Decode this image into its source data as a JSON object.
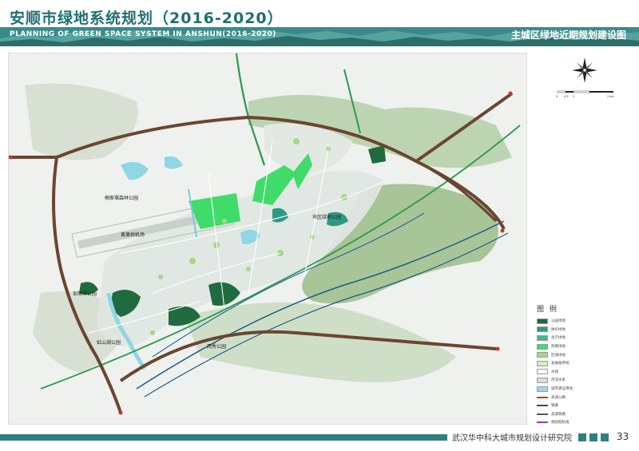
{
  "header": {
    "title_zh": "安顺市绿地系统规划（2016-2020）",
    "title_en": "PLANNING OF GREEN SPACE SYSTEM IN ANSHUN(2016-2020)",
    "subtitle": "主城区绿地近期规划建设图"
  },
  "map": {
    "labels": {
      "park_west": "梅家堰森林公园",
      "airport_line": "黄果树机场",
      "park_southwest": "安顺市公园",
      "park_south": "虹山湖公园",
      "park_east": "市区绿地公园",
      "park_se": "西秀公园"
    },
    "scale_bar": [
      "0",
      "0.5",
      "1",
      "2 km"
    ],
    "colors": {
      "background": "#eef1ee",
      "mountain_green": "#8fb57a",
      "ring_road": "#6b4530",
      "expressway": "#2a9a4a",
      "railway": "#1f5a88",
      "water": "#8fd6e6"
    }
  },
  "legend": {
    "title": "图 例",
    "items": [
      {
        "label": "公园绿地",
        "color": "#1f6b3f"
      },
      {
        "label": "防护绿地",
        "color": "#2b9a83"
      },
      {
        "label": "生产绿地",
        "color": "#3fb98f"
      },
      {
        "label": "附属绿地",
        "color": "#3fdc6a"
      },
      {
        "label": "区域绿地",
        "color": "#a6d68a"
      },
      {
        "label": "发展备用地",
        "color": "#dbe9c9"
      },
      {
        "label": "水域",
        "color": "#ffffff"
      },
      {
        "label": "河流水系",
        "color": "#d7dfe3"
      },
      {
        "label": "城市建设用地",
        "color": "#9ed6ee"
      },
      {
        "label": "高速公路",
        "color": "#c0392b"
      },
      {
        "label": "铁路",
        "color": "#6b3b2a"
      },
      {
        "label": "高速铁路",
        "color": "#555555"
      },
      {
        "label": "规划轻轨线",
        "color": "#8e44ad"
      }
    ]
  },
  "footer": {
    "institute": "武汉华中科大城市规划设计研究院",
    "page_number": "33"
  }
}
